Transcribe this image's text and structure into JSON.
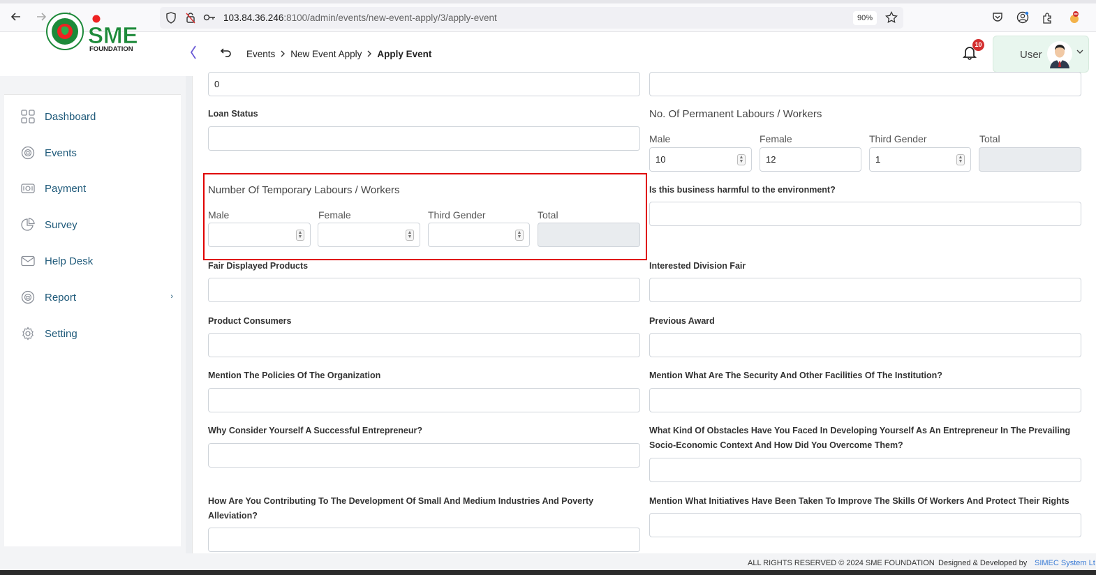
{
  "browser": {
    "url_host": "103.84.36.246",
    "url_path": ":8100/admin/events/new-event-apply/3/apply-event",
    "zoom": "90%"
  },
  "header": {
    "breadcrumb": [
      "Events",
      "New Event Apply",
      "Apply Event"
    ],
    "notification_count": "10",
    "user_label": "User",
    "logo_text": "SME",
    "logo_subtext": "FOUNDATION"
  },
  "sidebar": {
    "items": [
      {
        "label": "Dashboard",
        "icon": "grid-icon"
      },
      {
        "label": "Events",
        "icon": "badge-icon"
      },
      {
        "label": "Payment",
        "icon": "money-icon"
      },
      {
        "label": "Survey",
        "icon": "pie-icon"
      },
      {
        "label": "Help Desk",
        "icon": "mail-icon"
      },
      {
        "label": "Report",
        "icon": "badge-icon"
      },
      {
        "label": "Setting",
        "icon": "gear-icon"
      }
    ],
    "report_chevron": "›"
  },
  "form": {
    "top_left_value": "0",
    "loan_status_label": "Loan Status",
    "permanent_title": "No. Of Permanent Labours / Workers",
    "permanent": {
      "male_label": "Male",
      "male_value": "10",
      "female_label": "Female",
      "female_value": "12",
      "third_label": "Third Gender",
      "third_value": "1",
      "total_label": "Total"
    },
    "temporary_title": "Number Of Temporary Labours / Workers",
    "temporary": {
      "male_label": "Male",
      "female_label": "Female",
      "third_label": "Third Gender",
      "total_label": "Total"
    },
    "harmful_label": "Is this business harmful to the environment?",
    "fair_products_label": "Fair Displayed Products",
    "division_fair_label": "Interested Division Fair",
    "consumers_label": "Product Consumers",
    "award_label": "Previous Award",
    "policies_label": "Mention The Policies Of The Organization",
    "security_label": "Mention What Are The Security And Other Facilities Of The Institution?",
    "successful_label": "Why Consider Yourself A Successful Entrepreneur?",
    "obstacles_label": "What Kind Of Obstacles Have You Faced In Developing Yourself As An Entrepreneur In The Prevailing Socio-Economic Context And How Did You Overcome Them?",
    "contributing_label": "How Are You Contributing To The Development Of Small And Medium Industries And Poverty Alleviation?",
    "initiatives_label": "Mention What Initiatives Have Been Taken To Improve The Skills Of Workers And Protect Their Rights"
  },
  "footer": {
    "rights": "ALL RIGHTS RESERVED © 2024 SME FOUNDATION",
    "designed": "Designed & Developed by",
    "company": "SIMEC System Lt"
  },
  "colors": {
    "accent": "#1f5a7a",
    "highlight": "#e00000",
    "badge": "#d32f2f"
  }
}
